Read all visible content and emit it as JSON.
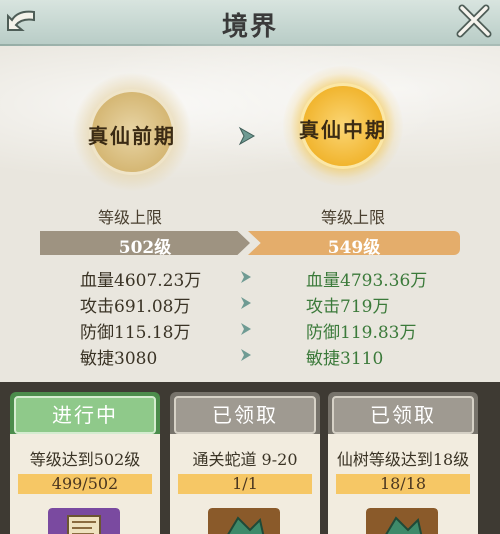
{
  "header": {
    "title": "境界"
  },
  "realm": {
    "current": "真仙前期",
    "next": "真仙中期",
    "cap_label_left": "等级上限",
    "cap_label_right": "等级上限",
    "cap_left": "502级",
    "cap_right": "549级"
  },
  "stats": [
    {
      "from": "血量4607.23万",
      "to": "血量4793.36万"
    },
    {
      "from": "攻击691.08万",
      "to": "攻击719万"
    },
    {
      "from": "防御115.18万",
      "to": "防御119.83万"
    },
    {
      "from": "敏捷3080",
      "to": "敏捷3110"
    }
  ],
  "tasks": [
    {
      "status": "进行中",
      "desc": "等级达到502级",
      "progress": "499/502"
    },
    {
      "status": "已领取",
      "desc": "通关蛇道 9-20",
      "progress": "1/1"
    },
    {
      "status": "已领取",
      "desc": "仙树等级达到18级",
      "progress": "18/18"
    }
  ],
  "icons": {
    "back": "back-arrow-icon",
    "close": "close-icon",
    "arrow": "arrow-right-icon",
    "reward1": "scroll-item-icon",
    "reward2": "gem-chest-icon",
    "reward3": "gem-chest-icon"
  },
  "colors": {
    "upgrade_text": "#3b7a3a",
    "in_progress": "#8fc98a",
    "claimed": "#9f9a91",
    "next_cap_bar": "#e4ad6b"
  }
}
